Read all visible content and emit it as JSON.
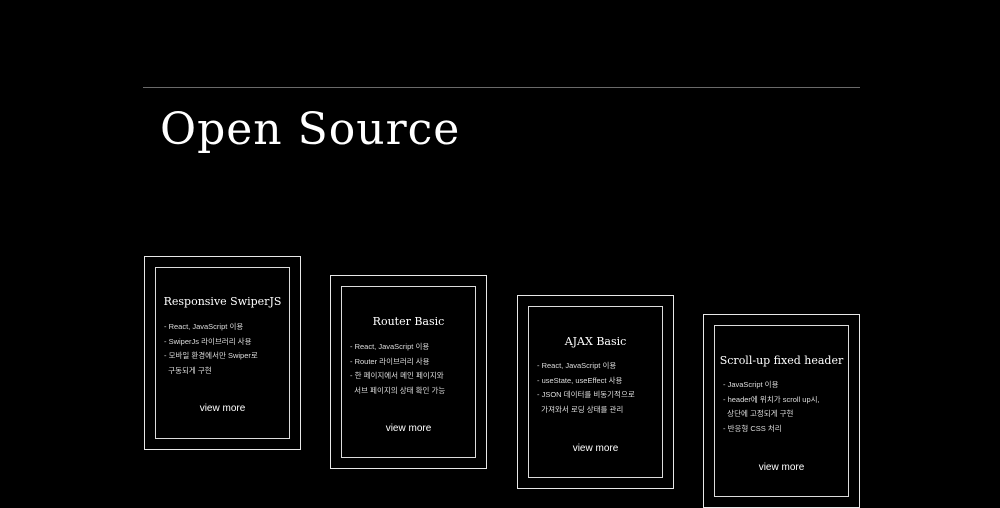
{
  "section": {
    "title": "Open Source"
  },
  "cards": [
    {
      "title": "Responsive SwiperJS",
      "items": [
        "- React, JavaScript 이용",
        "- SwiperJs 라이브러리 사용",
        "- 모바일 환경에서만 Swiper로",
        "  구동되게 구현"
      ],
      "link": "view more"
    },
    {
      "title": "Router Basic",
      "items": [
        "- React, JavaScript 이용",
        "- Router 라이브러리 사용",
        "- 한 페이지에서 메인 페이지와",
        "  서브 페이지의 상태 확인 가능"
      ],
      "link": "view more"
    },
    {
      "title": "AJAX Basic",
      "items": [
        "- React, JavaScript 이용",
        "- useState, useEffect 사용",
        "- JSON 데이터를 비동기적으로",
        "  가져와서 로딩 상태를 관리"
      ],
      "link": "view more"
    },
    {
      "title": "Scroll-up fixed header",
      "items": [
        "- JavaScript 이용",
        "- header에 위치가 scroll up시,",
        "  상단에 고정되게 구현",
        "- 반응형 CSS 처리"
      ],
      "link": "view more"
    }
  ]
}
